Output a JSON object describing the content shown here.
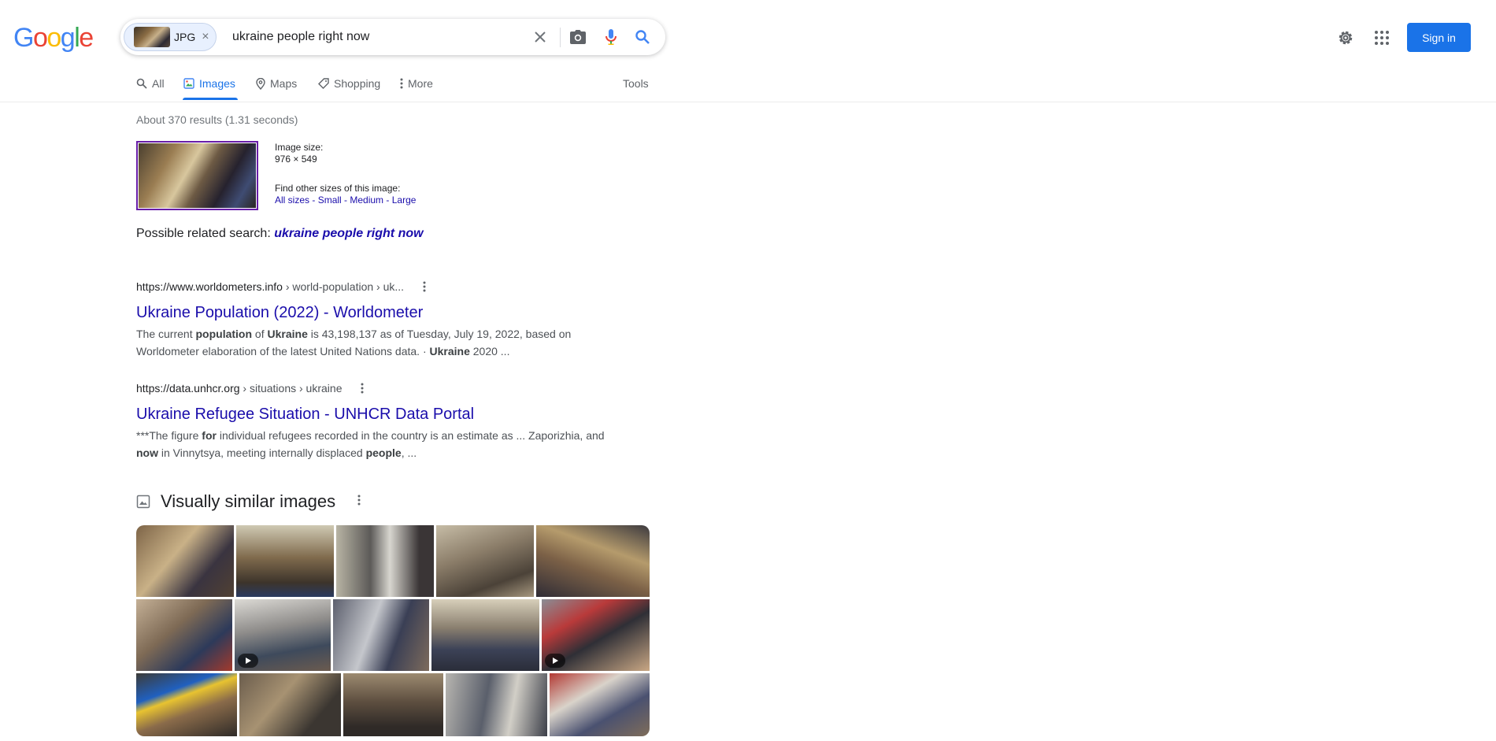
{
  "header": {
    "logo_letters": [
      {
        "ch": "G",
        "color": "#4285f4"
      },
      {
        "ch": "o",
        "color": "#ea4335"
      },
      {
        "ch": "o",
        "color": "#fbbc05"
      },
      {
        "ch": "g",
        "color": "#4285f4"
      },
      {
        "ch": "l",
        "color": "#34a853"
      },
      {
        "ch": "e",
        "color": "#ea4335"
      }
    ],
    "chip_label": "JPG",
    "chip_close": "×",
    "query": "ukraine people right now",
    "sign_in": "Sign in"
  },
  "tabs": {
    "all": "All",
    "images": "Images",
    "maps": "Maps",
    "shopping": "Shopping",
    "more": "More",
    "tools": "Tools"
  },
  "stats": "About 370 results (1.31 seconds)",
  "image_info": {
    "size_label": "Image size:",
    "size_value": "976 × 549",
    "other_label": "Find other sizes of this image:",
    "all_sizes": "All sizes",
    "small": "Small",
    "medium": "Medium",
    "large": "Large",
    "sep": " - "
  },
  "related": {
    "prefix": "Possible related search: ",
    "term": "ukraine people right now"
  },
  "results": [
    {
      "domain": "https://www.worldometers.info",
      "crumbs": " › world-population › uk...",
      "title": "Ukraine Population (2022) - Worldometer",
      "snippet_1a": "The current ",
      "snippet_1b": "population",
      "snippet_1c": " of ",
      "snippet_1d": "Ukraine",
      "snippet_1e": " is 43,198,137 as of Tuesday, July 19, 2022, based on",
      "snippet_2a": "Worldometer elaboration of the latest United Nations data. · ",
      "snippet_2b": "Ukraine",
      "snippet_2c": " 2020 ..."
    },
    {
      "domain": "https://data.unhcr.org",
      "crumbs": " › situations › ukraine",
      "title": "Ukraine Refugee Situation - UNHCR Data Portal",
      "snippet_1a": "***The figure ",
      "snippet_1b": "for",
      "snippet_1c": " individual refugees recorded in the country is an estimate as ... Zaporizhia, and",
      "snippet_2a": "now",
      "snippet_2b": " in Vinnytsya, meeting internally displaced ",
      "snippet_2c": "people",
      "snippet_2d": ", ..."
    }
  ],
  "visually_similar": {
    "title": "Visually similar images"
  },
  "colors": {
    "accent": "#1a73e8",
    "link": "#1a0dab",
    "visited_border": "#681da8"
  }
}
